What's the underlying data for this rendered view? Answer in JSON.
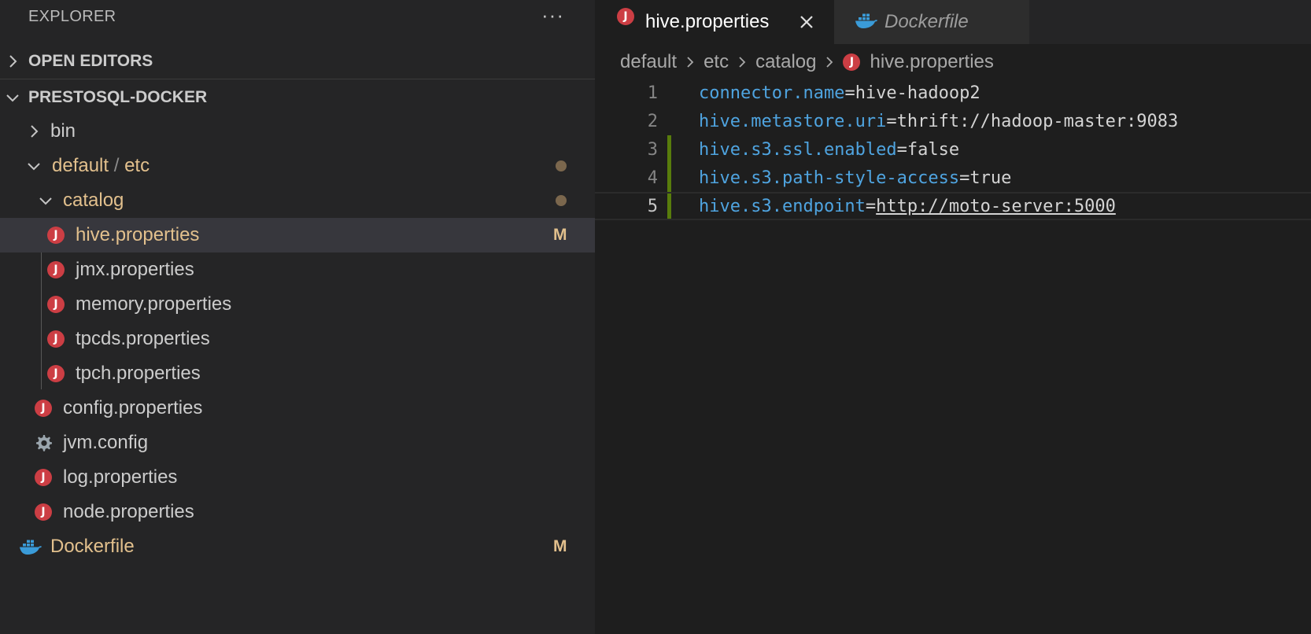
{
  "sidebar": {
    "title": "EXPLORER",
    "more_actions": "···",
    "sections": {
      "open_editors": "OPEN EDITORS",
      "project": "PRESTOSQL-DOCKER"
    },
    "tree": {
      "bin": "bin",
      "default_etc": {
        "part1": "default",
        "separator": "/",
        "part2": "etc"
      },
      "catalog": "catalog",
      "catalog_files": [
        "hive.properties",
        "jmx.properties",
        "memory.properties",
        "tpcds.properties",
        "tpch.properties"
      ],
      "etc_files": [
        "config.properties",
        "jvm.config",
        "log.properties",
        "node.properties"
      ],
      "dockerfile": "Dockerfile",
      "modified_badge": "M"
    }
  },
  "editor": {
    "tabs": [
      {
        "label": "hive.properties",
        "active": true
      },
      {
        "label": "Dockerfile",
        "active": false
      }
    ],
    "breadcrumb": [
      "default",
      "etc",
      "catalog",
      "hive.properties"
    ],
    "lines": [
      {
        "number": "1",
        "key": "connector.name",
        "eq": "=",
        "value": "hive-hadoop2"
      },
      {
        "number": "2",
        "key": "hive.metastore.uri",
        "eq": "=",
        "value": "thrift://hadoop-master:9083"
      },
      {
        "number": "3",
        "key": "hive.s3.ssl.enabled",
        "eq": "=",
        "value": "false"
      },
      {
        "number": "4",
        "key": "hive.s3.path-style-access",
        "eq": "=",
        "value": "true"
      },
      {
        "number": "5",
        "key": "hive.s3.endpoint",
        "eq": "=",
        "value": "http://moto-server:5000"
      }
    ]
  },
  "colors": {
    "sidebar_bg": "#252526",
    "editor_bg": "#1e1e1e",
    "modified": "#e2c08d",
    "properties_icon": "#cc3e44",
    "docker_icon": "#3a9bd8",
    "property_key": "#4fa4e0",
    "gutter_added": "#587c0c"
  }
}
